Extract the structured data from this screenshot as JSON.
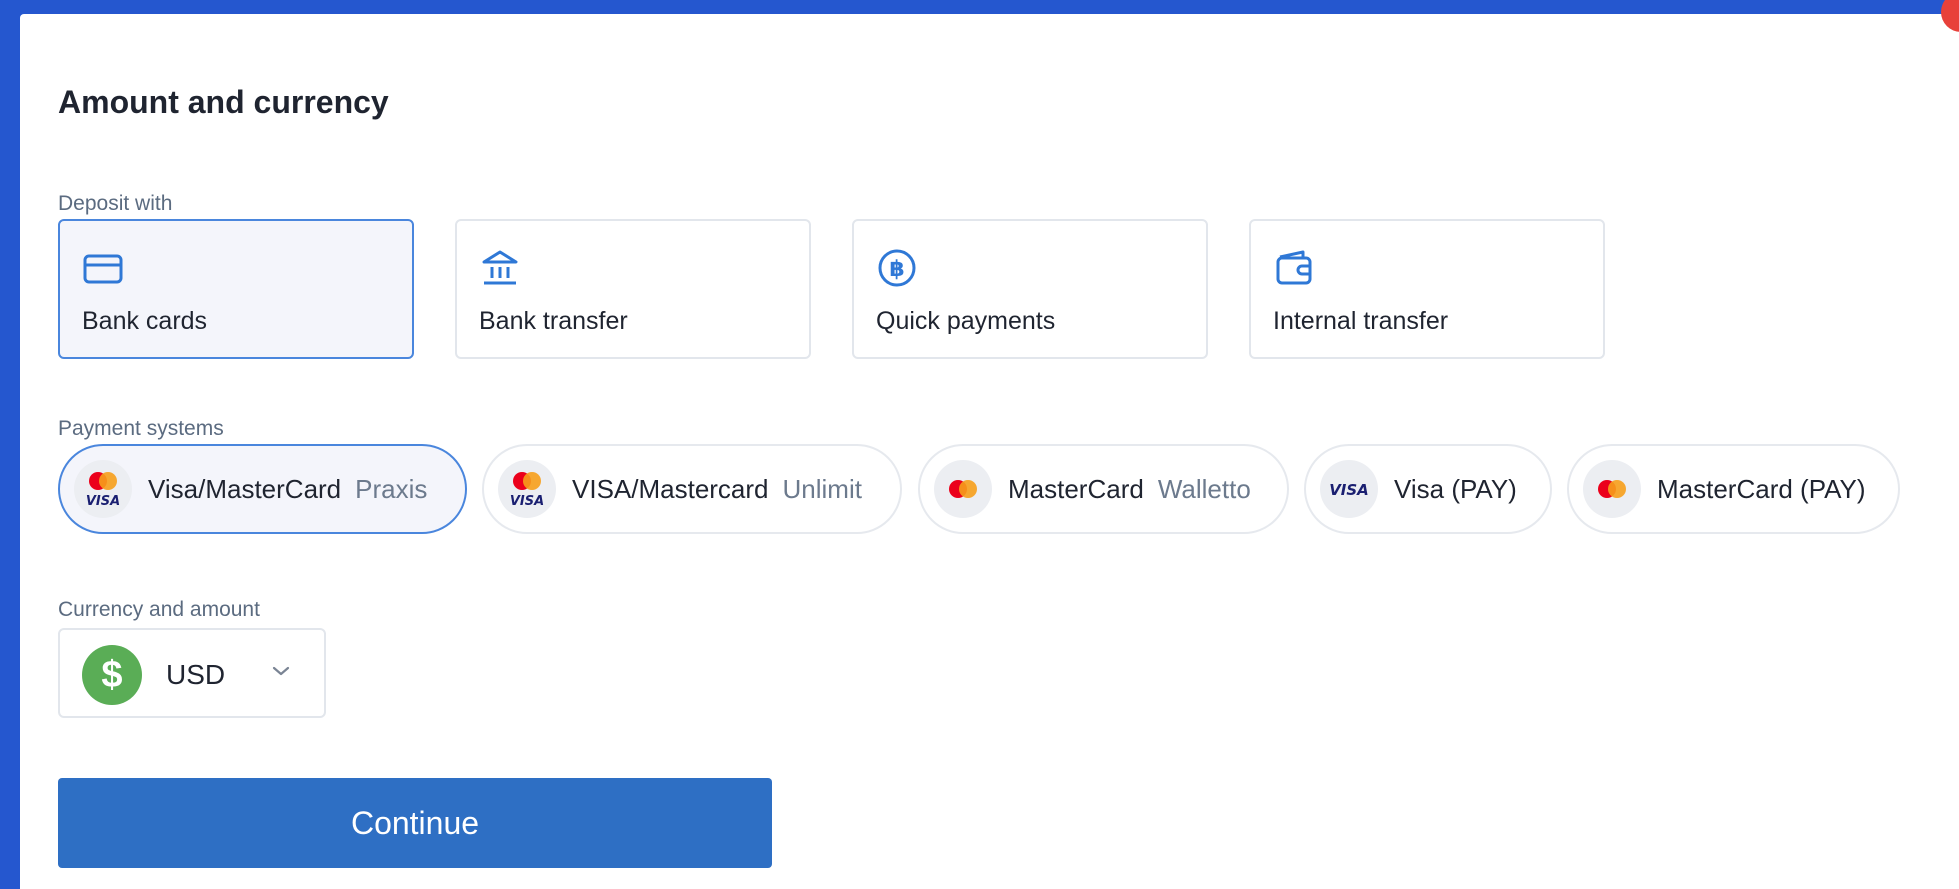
{
  "title": "Amount and currency",
  "deposit": {
    "label": "Deposit with",
    "methods": [
      {
        "label": "Bank cards",
        "icon": "credit-card-icon"
      },
      {
        "label": "Bank transfer",
        "icon": "bank-icon"
      },
      {
        "label": "Quick payments",
        "icon": "bitcoin-icon"
      },
      {
        "label": "Internal transfer",
        "icon": "wallet-icon"
      }
    ],
    "selected": "Bank cards"
  },
  "payment_systems": {
    "label": "Payment systems",
    "items": [
      {
        "name": "Visa/MasterCard",
        "provider": "Praxis",
        "logo": "visa-mastercard-logo"
      },
      {
        "name": "VISA/Mastercard",
        "provider": "Unlimit",
        "logo": "visa-mastercard-logo"
      },
      {
        "name": "MasterCard",
        "provider": "Walletto",
        "logo": "mastercard-logo"
      },
      {
        "name": "Visa (PAY)",
        "provider": "",
        "logo": "visa-logo"
      },
      {
        "name": "MasterCard (PAY)",
        "provider": "",
        "logo": "mastercard-logo"
      }
    ],
    "selected": "Visa/MasterCard Praxis"
  },
  "currency": {
    "label": "Currency and amount",
    "code": "USD",
    "symbol": "$",
    "icon": "dollar-coin-icon"
  },
  "continue_label": "Continue",
  "colors": {
    "frame": "#2557cf",
    "accent": "#2e6fc4",
    "selected_border": "#4a86dd",
    "icon": "#2f78d6",
    "mastercard_red": "#eb001b",
    "mastercard_orange": "#f79e1b",
    "visa_blue": "#1a1f71",
    "dollar_green": "#5aad56"
  }
}
